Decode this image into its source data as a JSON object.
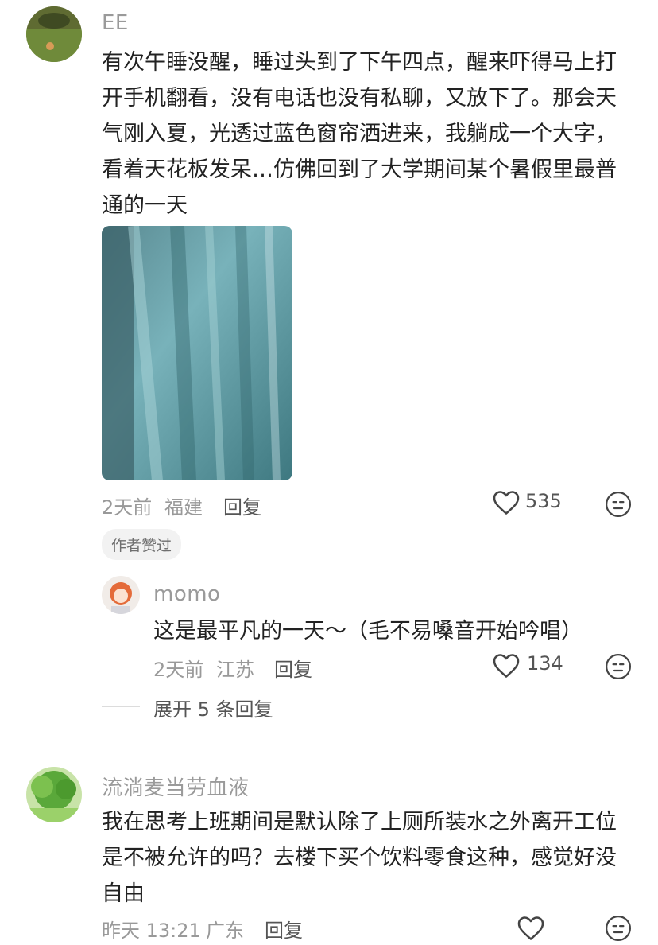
{
  "comments": [
    {
      "username": "EE",
      "text": "有次午睡没醒，睡过头到了下午四点，醒来吓得马上打开手机翻看，没有电话也没有私聊，又放下了。那会天气刚入夏，光透过蓝色窗帘洒进来，我躺成一个大字，看着天花板发呆…仿佛回到了大学期间某个暑假里最普通的一天",
      "time": "2天前",
      "location": "福建",
      "reply_label": "回复",
      "likes": "535",
      "badge": "作者赞过",
      "image_icon": "curtain-photo",
      "replies": [
        {
          "username": "momo",
          "text": "这是最平凡的一天～（毛不易嗓音开始吟唱）",
          "time": "2天前",
          "location": "江苏",
          "reply_label": "回复",
          "likes": "134"
        }
      ],
      "expand_label": "展开 5 条回复"
    },
    {
      "username": "流淌麦当劳血液",
      "text": "我在思考上班期间是默认除了上厕所装水之外离开工位是不被允许的吗？去楼下买个饮料零食这种，感觉好没自由",
      "time": "昨天 13:21",
      "location": "广东",
      "reply_label": "回复",
      "likes": ""
    }
  ],
  "icons": {
    "like": "heart-outline-icon",
    "emoji": "neutral-face-icon"
  }
}
